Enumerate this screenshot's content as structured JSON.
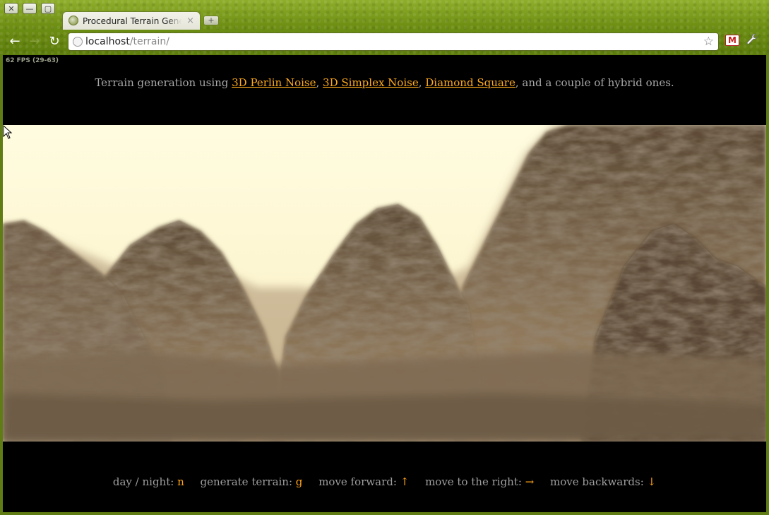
{
  "window": {
    "close_glyph": "✕",
    "minimize_glyph": "—",
    "maximize_glyph": "▢"
  },
  "tab": {
    "title": "Procedural Terrain Generation",
    "close_glyph": "×",
    "new_tab_glyph": "+"
  },
  "toolbar": {
    "back_glyph": "←",
    "forward_glyph": "→",
    "reload_glyph": "↻",
    "url_host": "localhost",
    "url_path": "/terrain/",
    "star_glyph": "☆",
    "gmail_glyph": "M",
    "wrench_glyph": "🔧"
  },
  "page": {
    "fps": "62 FPS (29-63)",
    "intro_prefix": "Terrain generation using ",
    "links": [
      {
        "label": "3D Perlin Noise"
      },
      {
        "label": "3D Simplex Noise"
      },
      {
        "label": "Diamond Square"
      }
    ],
    "intro_sep1": ", ",
    "intro_sep2": ", ",
    "intro_suffix": ", and a couple of hybrid ones.",
    "controls": [
      {
        "label": "day / night: ",
        "key": "n"
      },
      {
        "label": "generate terrain: ",
        "key": "g"
      },
      {
        "label": "move forward: ",
        "key": "↑"
      },
      {
        "label": "move to the right: ",
        "key": "→"
      },
      {
        "label": "move backwards: ",
        "key": "↓"
      }
    ]
  },
  "colors": {
    "link": "#ffaa1a",
    "key": "#ffa319",
    "sky": "#fffce0",
    "rock_dark": "#4a3a2a",
    "rock_light": "#b39a7a"
  }
}
